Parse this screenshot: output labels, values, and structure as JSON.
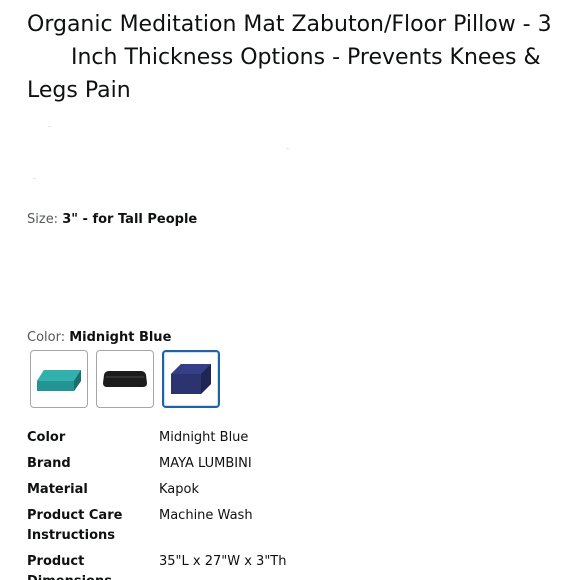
{
  "product": {
    "title_line1": "Organic Meditation Mat Zabuton/Floor Pillow - 3",
    "title_line2": "Inch Thickness Options - Prevents Knees &",
    "title_line3": "Legs Pain"
  },
  "size": {
    "label": "Size: ",
    "value": "3\" - for Tall People"
  },
  "color": {
    "label": "Color: ",
    "value": "Midnight Blue",
    "swatches": [
      {
        "name": "Teal",
        "fill": "#2a9c9a",
        "selected": false
      },
      {
        "name": "Black",
        "fill": "#1a1a1a",
        "selected": false
      },
      {
        "name": "Midnight Blue",
        "fill": "#2c3470",
        "selected": true
      }
    ]
  },
  "specs": {
    "rows": [
      {
        "key": "Color",
        "value": "Midnight Blue"
      },
      {
        "key": "Brand",
        "value": "MAYA LUMBINI"
      },
      {
        "key": "Material",
        "value": "Kapok"
      },
      {
        "key": "Product Care Instructions",
        "value": "Machine Wash"
      },
      {
        "key": "Product Dimensions",
        "value": "35\"L x 27\"W x 3\"Th"
      }
    ]
  }
}
